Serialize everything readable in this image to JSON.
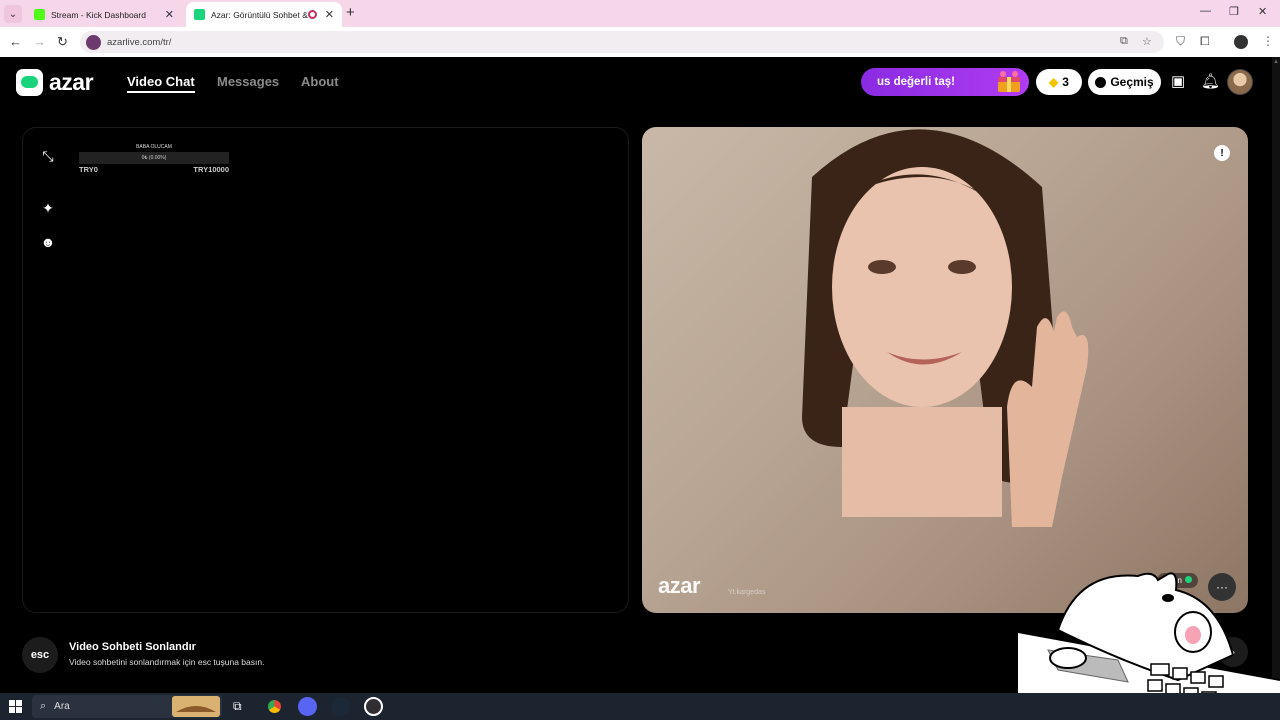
{
  "browser": {
    "tabs": [
      {
        "title": "Stream - Kick Dashboard",
        "favicon_color": "#53fc18"
      },
      {
        "title": "Azar: Görüntülü Sohbet & V",
        "favicon_color": "#19d47a"
      }
    ],
    "url": "azarlive.com/tr/"
  },
  "header": {
    "logo": "azar",
    "nav": [
      "Video Chat",
      "Messages",
      "About"
    ],
    "promo": "us değerli taş!",
    "gems": "3",
    "history": "Geçmiş"
  },
  "left_panel": {
    "goal_title": "BABA OLUCAM",
    "goal_progress": "0₺ (0.00%)",
    "goal_min": "TRY0",
    "goal_max": "TRY10000"
  },
  "right_panel": {
    "watermark": "azar",
    "watermark_sub": "Yt.kargedas",
    "peer_name": "aşkın"
  },
  "footer": {
    "esc_key": "esc",
    "title": "Video Sohbeti Sonlandır",
    "description": "Video sohbetini sonlandırmak için esc tuşuna basın."
  },
  "taskbar": {
    "search_placeholder": "Ara"
  },
  "colors": {
    "brand": "#19d47a",
    "promo": "#a13cf0",
    "tabbar": "#f6d7ea"
  }
}
